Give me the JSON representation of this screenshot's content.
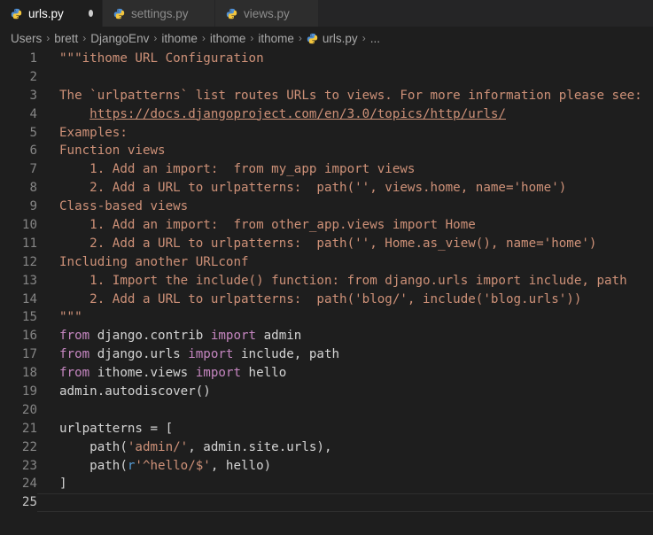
{
  "tabs": [
    {
      "label": "urls.py",
      "active": true,
      "modified": true,
      "icon": "python-icon"
    },
    {
      "label": "settings.py",
      "active": false,
      "icon": "python-icon"
    },
    {
      "label": "views.py",
      "active": false,
      "icon": "python-icon"
    }
  ],
  "breadcrumb": [
    "Users",
    "brett",
    "DjangoEnv",
    "ithome",
    "ithome",
    "ithome",
    "urls.py",
    "..."
  ],
  "colors": {
    "string": "#ce9178",
    "keyword": "#c586c0",
    "text": "#d4d4d4",
    "line_number": "#858585",
    "background": "#1e1e1e"
  },
  "code_lines": [
    {
      "n": "1",
      "tokens": [
        {
          "t": "\"\"\"ithome URL Configuration",
          "c": "str"
        }
      ]
    },
    {
      "n": "2",
      "tokens": []
    },
    {
      "n": "3",
      "tokens": [
        {
          "t": "The `urlpatterns` list routes URLs to views. For more information please see:",
          "c": "str"
        }
      ]
    },
    {
      "n": "4",
      "tokens": [
        {
          "t": "    ",
          "c": "str"
        },
        {
          "t": "https://docs.djangoproject.com/en/3.0/topics/http/urls/",
          "c": "str link"
        }
      ]
    },
    {
      "n": "5",
      "tokens": [
        {
          "t": "Examples:",
          "c": "str"
        }
      ]
    },
    {
      "n": "6",
      "tokens": [
        {
          "t": "Function views",
          "c": "str"
        }
      ]
    },
    {
      "n": "7",
      "tokens": [
        {
          "t": "    1. Add an import:  from my_app import views",
          "c": "str"
        }
      ]
    },
    {
      "n": "8",
      "tokens": [
        {
          "t": "    2. Add a URL to urlpatterns:  path('', views.home, name='home')",
          "c": "str"
        }
      ]
    },
    {
      "n": "9",
      "tokens": [
        {
          "t": "Class-based views",
          "c": "str"
        }
      ]
    },
    {
      "n": "10",
      "tokens": [
        {
          "t": "    1. Add an import:  from other_app.views import Home",
          "c": "str"
        }
      ]
    },
    {
      "n": "11",
      "tokens": [
        {
          "t": "    2. Add a URL to urlpatterns:  path('', Home.as_view(), name='home')",
          "c": "str"
        }
      ]
    },
    {
      "n": "12",
      "tokens": [
        {
          "t": "Including another URLconf",
          "c": "str"
        }
      ]
    },
    {
      "n": "13",
      "tokens": [
        {
          "t": "    1. Import the include() function: from django.urls import include, path",
          "c": "str"
        }
      ]
    },
    {
      "n": "14",
      "tokens": [
        {
          "t": "    2. Add a URL to urlpatterns:  path('blog/', include('blog.urls'))",
          "c": "str"
        }
      ]
    },
    {
      "n": "15",
      "tokens": [
        {
          "t": "\"\"\"",
          "c": "str"
        }
      ]
    },
    {
      "n": "16",
      "tokens": [
        {
          "t": "from",
          "c": "kw"
        },
        {
          "t": " django.contrib ",
          "c": "plain"
        },
        {
          "t": "import",
          "c": "kw"
        },
        {
          "t": " admin",
          "c": "plain"
        }
      ]
    },
    {
      "n": "17",
      "tokens": [
        {
          "t": "from",
          "c": "kw"
        },
        {
          "t": " django.urls ",
          "c": "plain"
        },
        {
          "t": "import",
          "c": "kw"
        },
        {
          "t": " include, path",
          "c": "plain"
        }
      ]
    },
    {
      "n": "18",
      "tokens": [
        {
          "t": "from",
          "c": "kw"
        },
        {
          "t": " ithome.views ",
          "c": "plain"
        },
        {
          "t": "import",
          "c": "kw"
        },
        {
          "t": " hello",
          "c": "plain"
        }
      ]
    },
    {
      "n": "19",
      "tokens": [
        {
          "t": "admin.autodiscover()",
          "c": "plain"
        }
      ]
    },
    {
      "n": "20",
      "tokens": []
    },
    {
      "n": "21",
      "tokens": [
        {
          "t": "urlpatterns = [",
          "c": "plain"
        }
      ]
    },
    {
      "n": "22",
      "tokens": [
        {
          "t": "    path(",
          "c": "plain"
        },
        {
          "t": "'admin/'",
          "c": "str"
        },
        {
          "t": ", admin.site.urls),",
          "c": "plain"
        }
      ]
    },
    {
      "n": "23",
      "tokens": [
        {
          "t": "    path(",
          "c": "plain"
        },
        {
          "t": "r",
          "c": "prefix"
        },
        {
          "t": "'^hello/$'",
          "c": "str"
        },
        {
          "t": ", hello)",
          "c": "plain"
        }
      ]
    },
    {
      "n": "24",
      "tokens": [
        {
          "t": "]",
          "c": "plain"
        }
      ]
    },
    {
      "n": "25",
      "tokens": [],
      "current": true
    }
  ]
}
